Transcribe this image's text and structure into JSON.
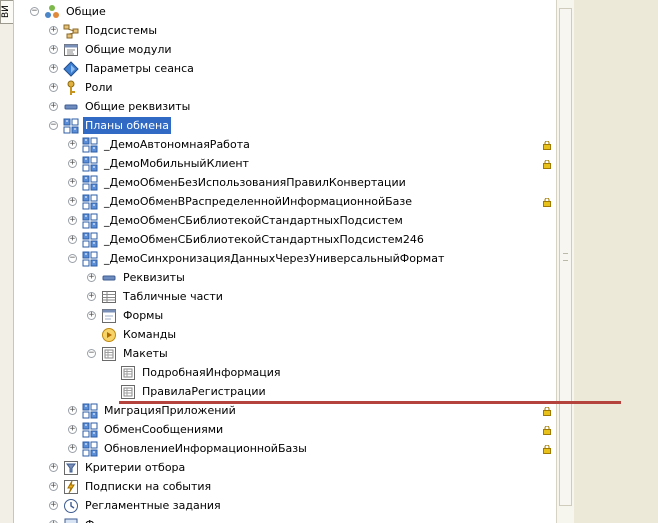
{
  "left_tab_label": "ВИ",
  "tree": [
    {
      "label": "Общие",
      "toggle": "−",
      "icon": "common-icon"
    },
    {
      "label": "Подсистемы",
      "toggle": "+",
      "icon": "subsystems-icon"
    },
    {
      "label": "Общие модули",
      "toggle": "+",
      "icon": "module-icon"
    },
    {
      "label": "Параметры сеанса",
      "toggle": "+",
      "icon": "session-params-icon"
    },
    {
      "label": "Роли",
      "toggle": "+",
      "icon": "role-icon"
    },
    {
      "label": "Общие реквизиты",
      "toggle": "+",
      "icon": "attribute-icon"
    },
    {
      "label": "Планы обмена",
      "toggle": "−",
      "icon": "exchange-plan-icon",
      "selected": true
    },
    {
      "label": "_ДемоАвтономнаяРабота",
      "toggle": "+",
      "icon": "exchange-plan-icon",
      "locked": true
    },
    {
      "label": "_ДемоМобильныйКлиент",
      "toggle": "+",
      "icon": "exchange-plan-icon",
      "locked": true
    },
    {
      "label": "_ДемоОбменБезИспользованияПравилКонвертации",
      "toggle": "+",
      "icon": "exchange-plan-icon"
    },
    {
      "label": "_ДемоОбменВРаспределеннойИнформационнойБазе",
      "toggle": "+",
      "icon": "exchange-plan-icon",
      "locked": true
    },
    {
      "label": "_ДемоОбменСБиблиотекойСтандартныхПодсистем",
      "toggle": "+",
      "icon": "exchange-plan-icon"
    },
    {
      "label": "_ДемоОбменСБиблиотекойСтандартныхПодсистем246",
      "toggle": "+",
      "icon": "exchange-plan-icon"
    },
    {
      "label": "_ДемоСинхронизацияДанныхЧерезУниверсальныйФормат",
      "toggle": "−",
      "icon": "exchange-plan-icon"
    },
    {
      "label": "Реквизиты",
      "toggle": "+",
      "icon": "attribute-icon"
    },
    {
      "label": "Табличные части",
      "toggle": "+",
      "icon": "table-icon"
    },
    {
      "label": "Формы",
      "toggle": "+",
      "icon": "form-icon"
    },
    {
      "label": "Команды",
      "toggle": "",
      "icon": "command-icon"
    },
    {
      "label": "Макеты",
      "toggle": "−",
      "icon": "template-icon"
    },
    {
      "label": "ПодробнаяИнформация",
      "toggle": "",
      "icon": "template-icon"
    },
    {
      "label": "ПравилаРегистрации",
      "toggle": "",
      "icon": "template-icon"
    },
    {
      "label": "МиграцияПриложений",
      "toggle": "+",
      "icon": "exchange-plan-icon",
      "locked": true
    },
    {
      "label": "ОбменСообщениями",
      "toggle": "+",
      "icon": "exchange-plan-icon",
      "locked": true
    },
    {
      "label": "ОбновлениеИнформационнойБазы",
      "toggle": "+",
      "icon": "exchange-plan-icon",
      "locked": true
    },
    {
      "label": "Критерии отбора",
      "toggle": "+",
      "icon": "filter-criteria-icon"
    },
    {
      "label": "Подписки на события",
      "toggle": "+",
      "icon": "event-subscription-icon"
    },
    {
      "label": "Регламентные задания",
      "toggle": "+",
      "icon": "scheduled-job-icon"
    },
    {
      "label": "Ф",
      "toggle": "+",
      "icon": "functional-option-icon"
    }
  ],
  "colors": {
    "selection": "#316ac5",
    "annotation_line": "#b5433d",
    "lock": "#e8c21a"
  }
}
